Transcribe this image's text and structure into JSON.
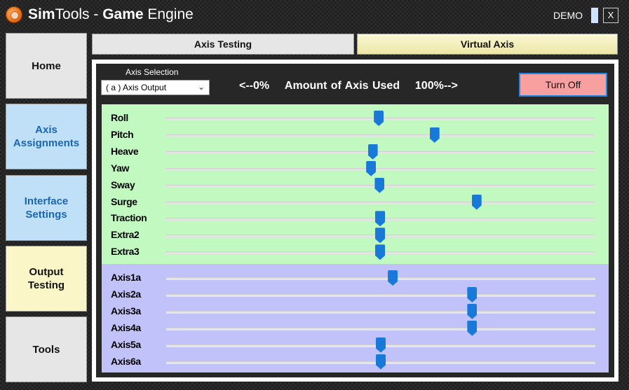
{
  "window": {
    "title_bold_1": "Sim",
    "title_light_1": "Tools - ",
    "title_bold_2": "Game",
    "title_light_2": " Engine",
    "demo_label": "DEMO",
    "close_label": "X"
  },
  "sidebar": {
    "home": "Home",
    "axis_assignments": "Axis\nAssignments",
    "interface_settings": "Interface\nSettings",
    "output_testing": "Output\nTesting",
    "tools": "Tools"
  },
  "tabs": {
    "axis_testing": "Axis Testing",
    "virtual_axis": "Virtual Axis"
  },
  "controls": {
    "axis_selection_label": "Axis Selection",
    "axis_selection_value": "( a ) Axis Output",
    "amount_left": "<--0%",
    "amount_mid": "Amount of Axis Used",
    "amount_right": "100%-->",
    "turn_off_label": "Turn Off"
  },
  "axes_main": [
    {
      "label": "Roll",
      "level_pct": 49.7
    },
    {
      "label": "Pitch",
      "level_pct": 62.7
    },
    {
      "label": "Heave",
      "level_pct": 48.3
    },
    {
      "label": "Yaw",
      "level_pct": 47.9
    },
    {
      "label": "Sway",
      "level_pct": 49.9
    },
    {
      "label": "Surge",
      "level_pct": 72.5
    },
    {
      "label": "Traction",
      "level_pct": 50.0
    },
    {
      "label": "Extra2",
      "level_pct": 50.0
    },
    {
      "label": "Extra3",
      "level_pct": 50.0
    }
  ],
  "axes_virtual": [
    {
      "label": "Axis1a",
      "level_pct": 52.8
    },
    {
      "label": "Axis2a",
      "level_pct": 71.3
    },
    {
      "label": "Axis3a",
      "level_pct": 71.3
    },
    {
      "label": "Axis4a",
      "level_pct": 71.3
    },
    {
      "label": "Axis5a",
      "level_pct": 50.0
    },
    {
      "label": "Axis6a",
      "level_pct": 50.0
    }
  ],
  "colors": {
    "main_axes_bg": "#c1f9c1",
    "virtual_axes_bg": "#c2c2fa",
    "slider_thumb": "#1979d9",
    "turn_off_bg": "#f8a0a0"
  }
}
